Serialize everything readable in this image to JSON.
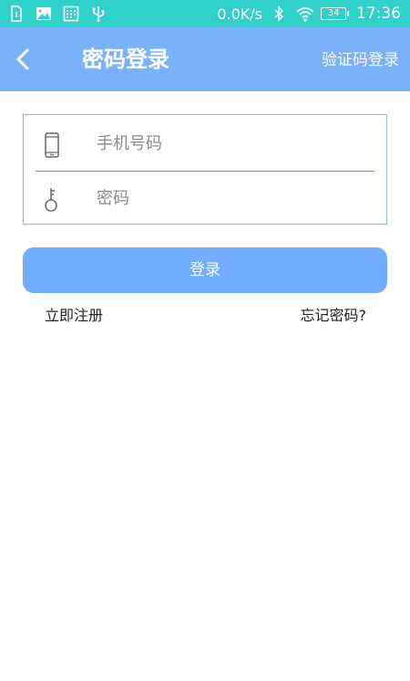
{
  "status_bar": {
    "left_icons": [
      "sim-card-icon",
      "image-icon",
      "calendar-icon",
      "usb-icon"
    ],
    "network_speed": "0.0K/s",
    "bluetooth_icon": "bluetooth-icon",
    "wifi_icon": "wifi-icon",
    "battery_level": "34",
    "time": "17:36"
  },
  "header": {
    "back_icon": "chevron-left-icon",
    "title": "密码登录",
    "switch_label": "验证码登录"
  },
  "form": {
    "phone": {
      "icon": "smartphone-icon",
      "placeholder": "手机号码",
      "value": ""
    },
    "password": {
      "icon": "key-icon",
      "placeholder": "密码",
      "value": ""
    }
  },
  "actions": {
    "login_label": "登录",
    "register_label": "立即注册",
    "forgot_label": "忘记密码?"
  },
  "colors": {
    "status_bar": "#2fd0c8",
    "header": "#79b2fb",
    "button": "#72acfb",
    "input_border": "#8fb7ea"
  }
}
